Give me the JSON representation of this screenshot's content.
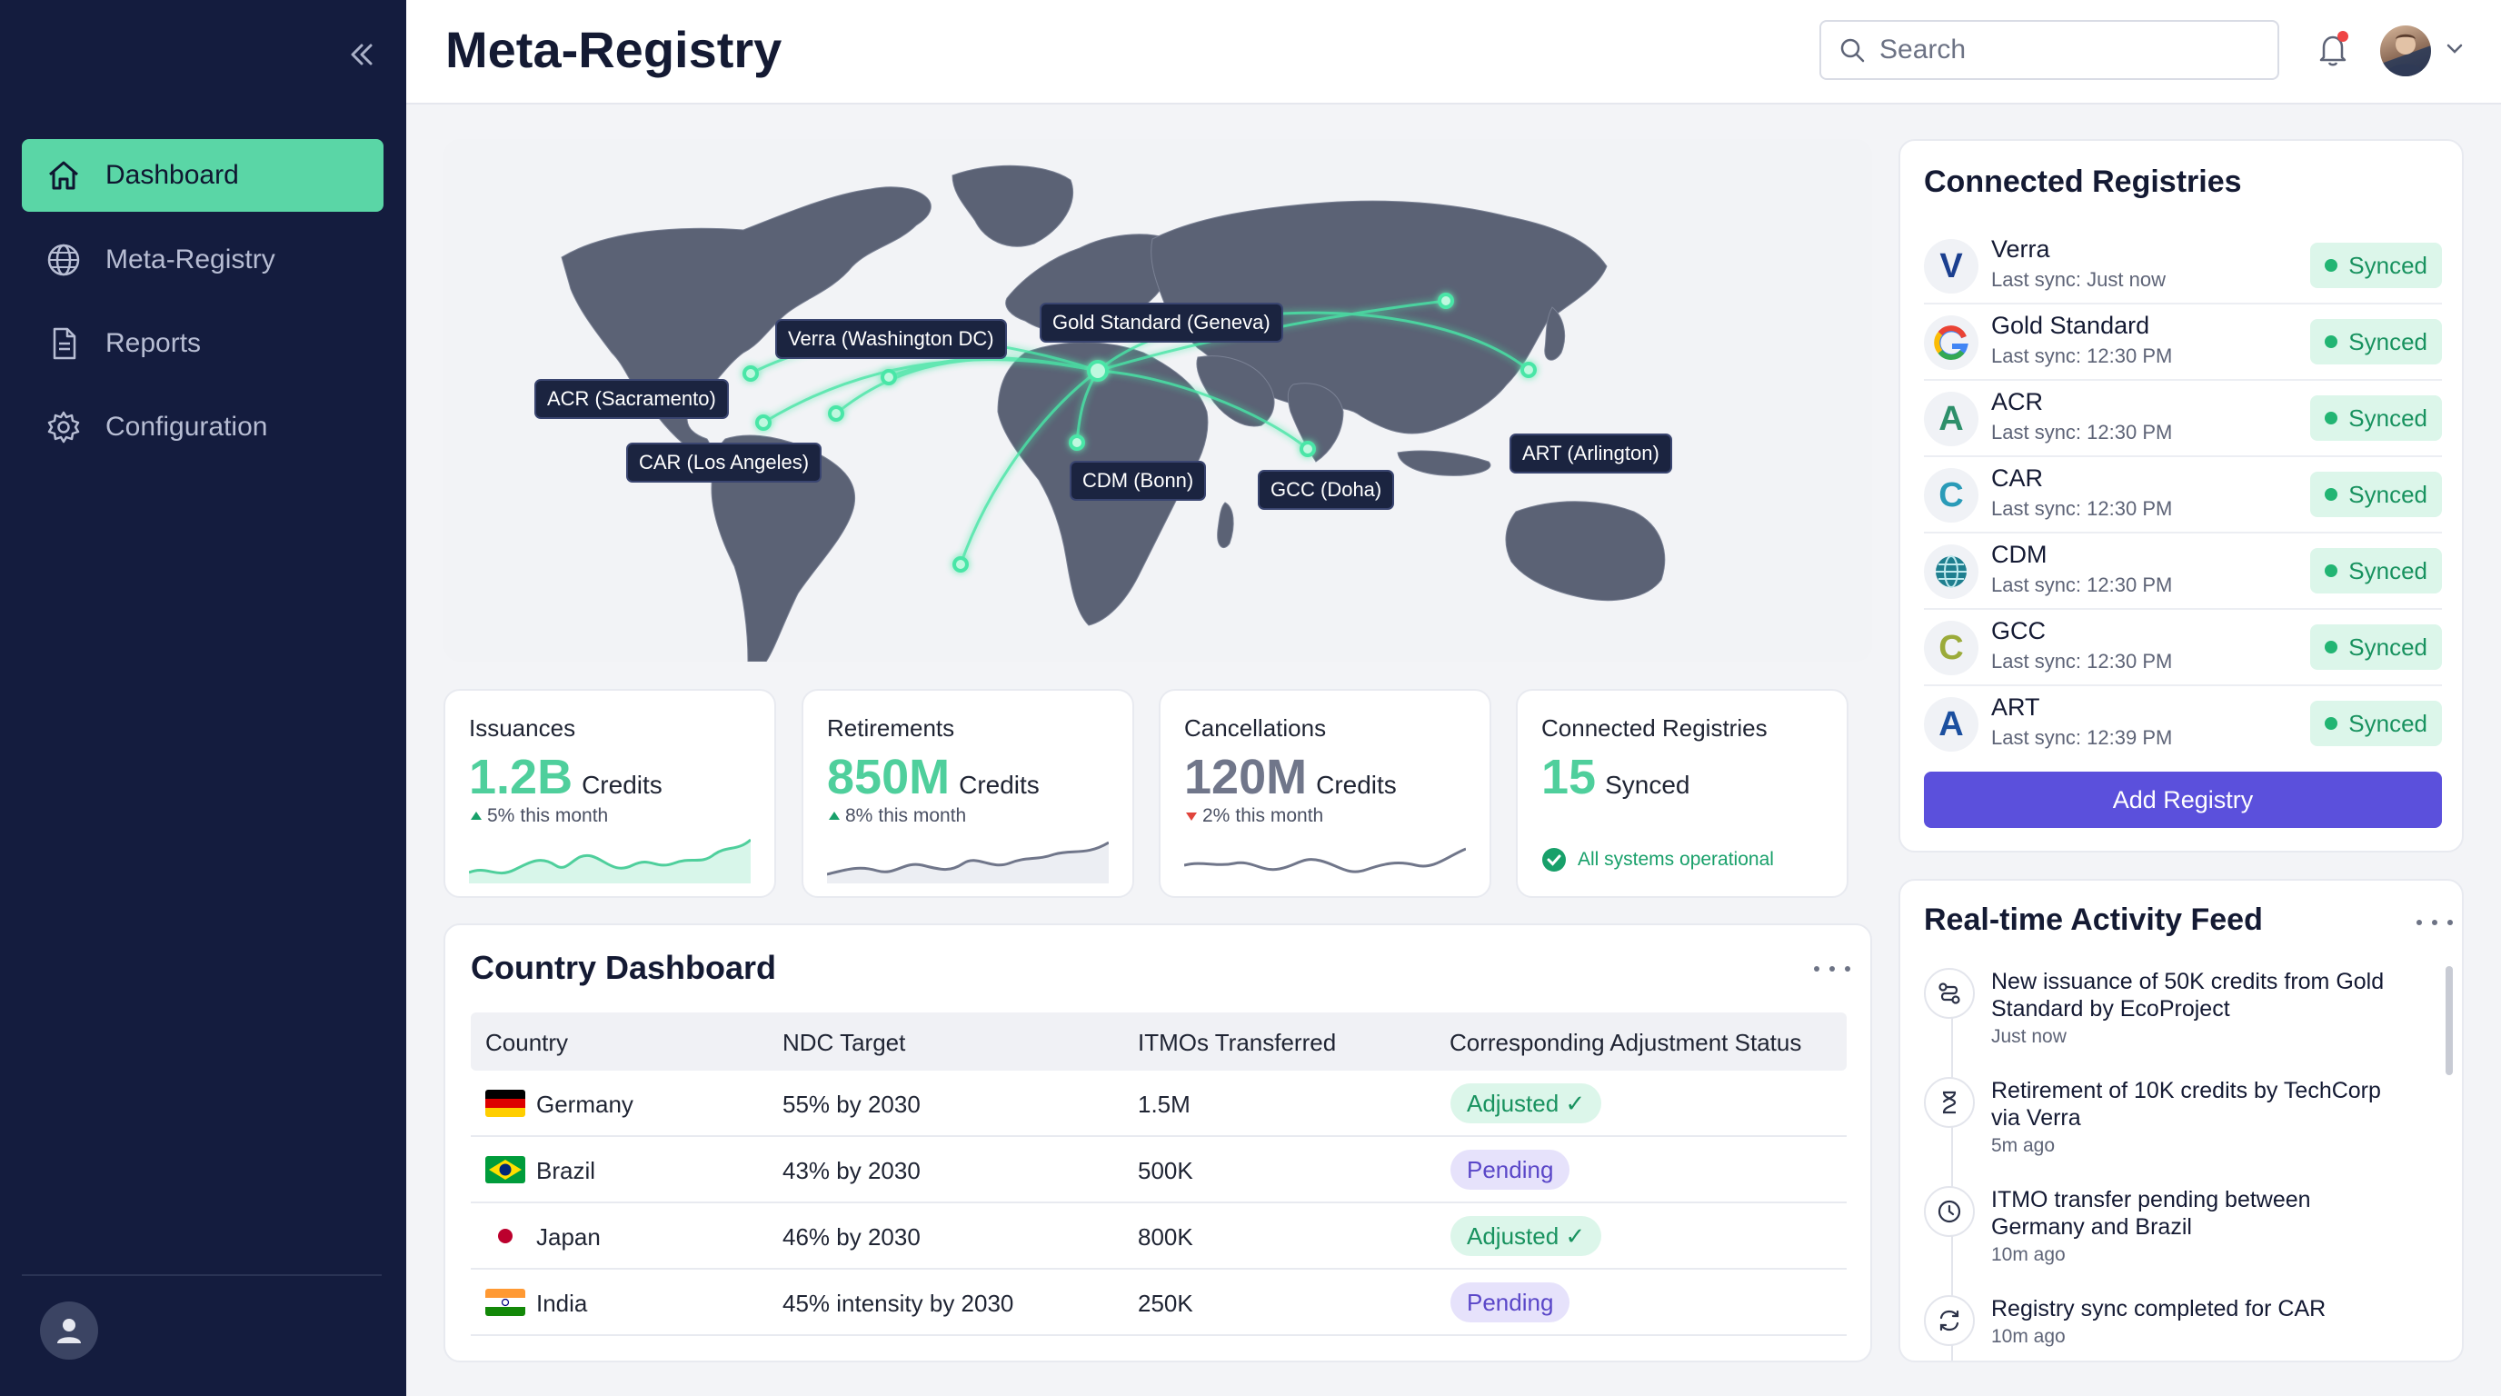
{
  "app": {
    "title": "Meta-Registry"
  },
  "sidebar": {
    "items": [
      {
        "label": "Dashboard",
        "icon": "home-icon",
        "active": true
      },
      {
        "label": "Meta-Registry",
        "icon": "globe-icon"
      },
      {
        "label": "Reports",
        "icon": "document-icon"
      },
      {
        "label": "Configuration",
        "icon": "gear-icon"
      }
    ]
  },
  "header": {
    "search_placeholder": "Search"
  },
  "map": {
    "locations": [
      {
        "label": "Verra (Washington DC)"
      },
      {
        "label": "Gold Standard (Geneva)"
      },
      {
        "label": "ACR (Sacramento)"
      },
      {
        "label": "CAR (Los Angeles)"
      },
      {
        "label": "CDM (Bonn)"
      },
      {
        "label": "GCC (Doha)"
      },
      {
        "label": "ART (Arlington)"
      }
    ],
    "colors": {
      "land": "#5b6275",
      "route": "#49e6a7",
      "label_bg": "#1b2440"
    }
  },
  "stats": {
    "issuances": {
      "label": "Issuances",
      "value": "1.2B",
      "unit": "Credits",
      "change": "5%",
      "change_text": "this month",
      "trend": "up"
    },
    "retirements": {
      "label": "Retirements",
      "value": "850M",
      "unit": "Credits",
      "change": "8%",
      "change_text": "this month",
      "trend": "up"
    },
    "cancellations": {
      "label": "Cancellations",
      "value": "120M",
      "unit": "Credits",
      "change": "2%",
      "change_text": "this month",
      "trend": "down"
    },
    "connected": {
      "label": "Connected Registries",
      "value": "15",
      "unit": "Synced",
      "status": "All systems operational"
    }
  },
  "country_dashboard": {
    "title": "Country Dashboard",
    "columns": [
      "Country",
      "NDC Target",
      "ITMOs Transferred",
      "Corresponding Adjustment Status"
    ],
    "rows": [
      {
        "country": "Germany",
        "ndc": "55% by 2030",
        "itmos": "1.5M",
        "status": "Adjusted ✓",
        "type": "adjusted"
      },
      {
        "country": "Brazil",
        "ndc": "43% by 2030",
        "itmos": "500K",
        "status": "Pending",
        "type": "pending"
      },
      {
        "country": "Japan",
        "ndc": "46% by 2030",
        "itmos": "800K",
        "status": "Adjusted ✓",
        "type": "adjusted"
      },
      {
        "country": "India",
        "ndc": "45% intensity by 2030",
        "itmos": "250K",
        "status": "Pending",
        "type": "pending"
      }
    ]
  },
  "registries": {
    "title": "Connected Registries",
    "items": [
      {
        "name": "Verra",
        "sync": "Last sync: Just now",
        "status": "Synced",
        "logo": "V",
        "color": "#1b3f8f"
      },
      {
        "name": "Gold Standard",
        "sync": "Last sync: 12:30 PM",
        "status": "Synced",
        "logo": "G",
        "color": "#e8a51a"
      },
      {
        "name": "ACR",
        "sync": "Last sync: 12:30 PM",
        "status": "Synced",
        "logo": "A",
        "color": "#2d8f6a"
      },
      {
        "name": "CAR",
        "sync": "Last sync: 12:30 PM",
        "status": "Synced",
        "logo": "C",
        "color": "#2a9bb8"
      },
      {
        "name": "CDM",
        "sync": "Last sync: 12:30 PM",
        "status": "Synced",
        "logo": "globe",
        "color": "#1f7f8f"
      },
      {
        "name": "GCC",
        "sync": "Last sync: 12:30 PM",
        "status": "Synced",
        "logo": "C",
        "color": "#9bab3a"
      },
      {
        "name": "ART",
        "sync": "Last sync: 12:39 PM",
        "status": "Synced",
        "logo": "A",
        "color": "#1b4f9f"
      }
    ],
    "add_button": "Add Registry"
  },
  "feed": {
    "title": "Real-time Activity Feed",
    "items": [
      {
        "text": "New issuance of 50K credits from Gold Standard by EcoProject",
        "time": "Just now",
        "icon": "route-icon"
      },
      {
        "text": "Retirement of 10K credits by TechCorp via Verra",
        "time": "5m ago",
        "icon": "hourglass-icon"
      },
      {
        "text": "ITMO transfer pending between Germany and Brazil",
        "time": "10m ago",
        "icon": "clock-icon"
      },
      {
        "text": "Registry sync completed for CAR",
        "time": "10m ago",
        "icon": "sync-icon"
      }
    ]
  }
}
